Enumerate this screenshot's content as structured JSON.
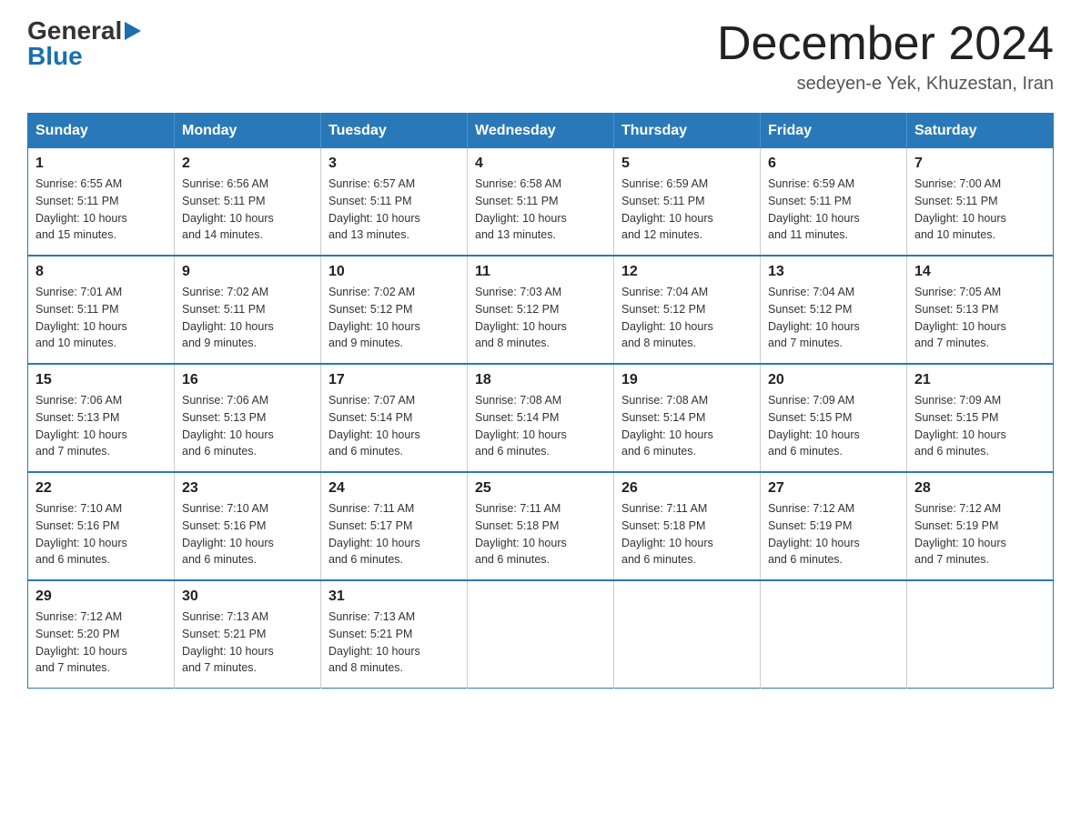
{
  "logo": {
    "general": "General",
    "blue": "Blue",
    "triangle": "▶"
  },
  "title": "December 2024",
  "location": "sedeyen-e Yek, Khuzestan, Iran",
  "headers": [
    "Sunday",
    "Monday",
    "Tuesday",
    "Wednesday",
    "Thursday",
    "Friday",
    "Saturday"
  ],
  "weeks": [
    [
      {
        "day": "1",
        "sunrise": "6:55 AM",
        "sunset": "5:11 PM",
        "daylight": "10 hours and 15 minutes."
      },
      {
        "day": "2",
        "sunrise": "6:56 AM",
        "sunset": "5:11 PM",
        "daylight": "10 hours and 14 minutes."
      },
      {
        "day": "3",
        "sunrise": "6:57 AM",
        "sunset": "5:11 PM",
        "daylight": "10 hours and 13 minutes."
      },
      {
        "day": "4",
        "sunrise": "6:58 AM",
        "sunset": "5:11 PM",
        "daylight": "10 hours and 13 minutes."
      },
      {
        "day": "5",
        "sunrise": "6:59 AM",
        "sunset": "5:11 PM",
        "daylight": "10 hours and 12 minutes."
      },
      {
        "day": "6",
        "sunrise": "6:59 AM",
        "sunset": "5:11 PM",
        "daylight": "10 hours and 11 minutes."
      },
      {
        "day": "7",
        "sunrise": "7:00 AM",
        "sunset": "5:11 PM",
        "daylight": "10 hours and 10 minutes."
      }
    ],
    [
      {
        "day": "8",
        "sunrise": "7:01 AM",
        "sunset": "5:11 PM",
        "daylight": "10 hours and 10 minutes."
      },
      {
        "day": "9",
        "sunrise": "7:02 AM",
        "sunset": "5:11 PM",
        "daylight": "10 hours and 9 minutes."
      },
      {
        "day": "10",
        "sunrise": "7:02 AM",
        "sunset": "5:12 PM",
        "daylight": "10 hours and 9 minutes."
      },
      {
        "day": "11",
        "sunrise": "7:03 AM",
        "sunset": "5:12 PM",
        "daylight": "10 hours and 8 minutes."
      },
      {
        "day": "12",
        "sunrise": "7:04 AM",
        "sunset": "5:12 PM",
        "daylight": "10 hours and 8 minutes."
      },
      {
        "day": "13",
        "sunrise": "7:04 AM",
        "sunset": "5:12 PM",
        "daylight": "10 hours and 7 minutes."
      },
      {
        "day": "14",
        "sunrise": "7:05 AM",
        "sunset": "5:13 PM",
        "daylight": "10 hours and 7 minutes."
      }
    ],
    [
      {
        "day": "15",
        "sunrise": "7:06 AM",
        "sunset": "5:13 PM",
        "daylight": "10 hours and 7 minutes."
      },
      {
        "day": "16",
        "sunrise": "7:06 AM",
        "sunset": "5:13 PM",
        "daylight": "10 hours and 6 minutes."
      },
      {
        "day": "17",
        "sunrise": "7:07 AM",
        "sunset": "5:14 PM",
        "daylight": "10 hours and 6 minutes."
      },
      {
        "day": "18",
        "sunrise": "7:08 AM",
        "sunset": "5:14 PM",
        "daylight": "10 hours and 6 minutes."
      },
      {
        "day": "19",
        "sunrise": "7:08 AM",
        "sunset": "5:14 PM",
        "daylight": "10 hours and 6 minutes."
      },
      {
        "day": "20",
        "sunrise": "7:09 AM",
        "sunset": "5:15 PM",
        "daylight": "10 hours and 6 minutes."
      },
      {
        "day": "21",
        "sunrise": "7:09 AM",
        "sunset": "5:15 PM",
        "daylight": "10 hours and 6 minutes."
      }
    ],
    [
      {
        "day": "22",
        "sunrise": "7:10 AM",
        "sunset": "5:16 PM",
        "daylight": "10 hours and 6 minutes."
      },
      {
        "day": "23",
        "sunrise": "7:10 AM",
        "sunset": "5:16 PM",
        "daylight": "10 hours and 6 minutes."
      },
      {
        "day": "24",
        "sunrise": "7:11 AM",
        "sunset": "5:17 PM",
        "daylight": "10 hours and 6 minutes."
      },
      {
        "day": "25",
        "sunrise": "7:11 AM",
        "sunset": "5:18 PM",
        "daylight": "10 hours and 6 minutes."
      },
      {
        "day": "26",
        "sunrise": "7:11 AM",
        "sunset": "5:18 PM",
        "daylight": "10 hours and 6 minutes."
      },
      {
        "day": "27",
        "sunrise": "7:12 AM",
        "sunset": "5:19 PM",
        "daylight": "10 hours and 6 minutes."
      },
      {
        "day": "28",
        "sunrise": "7:12 AM",
        "sunset": "5:19 PM",
        "daylight": "10 hours and 7 minutes."
      }
    ],
    [
      {
        "day": "29",
        "sunrise": "7:12 AM",
        "sunset": "5:20 PM",
        "daylight": "10 hours and 7 minutes."
      },
      {
        "day": "30",
        "sunrise": "7:13 AM",
        "sunset": "5:21 PM",
        "daylight": "10 hours and 7 minutes."
      },
      {
        "day": "31",
        "sunrise": "7:13 AM",
        "sunset": "5:21 PM",
        "daylight": "10 hours and 8 minutes."
      },
      null,
      null,
      null,
      null
    ]
  ],
  "labels": {
    "sunrise": "Sunrise:",
    "sunset": "Sunset:",
    "daylight": "Daylight:"
  }
}
